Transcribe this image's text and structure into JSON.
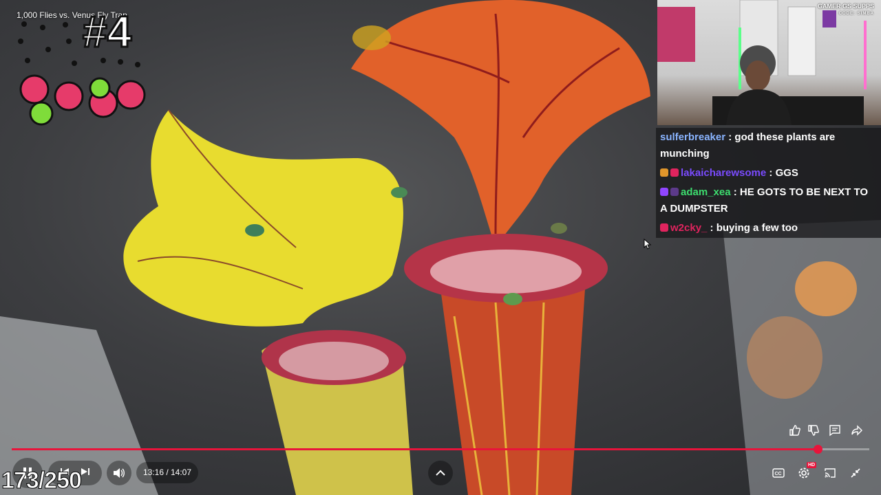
{
  "video": {
    "title": "1,000 Flies vs. Venus Fly Trap",
    "episode_label": "#4",
    "counter": "173/250",
    "time": "13:16 / 14:07",
    "progress": 0.94,
    "quality_badge": "HD"
  },
  "webcam": {
    "sponsor_brand": "GAMER GS SUPPS",
    "sponsor_code": "CODE: SIMBA"
  },
  "chat": {
    "messages": [
      {
        "user": "sulferbreaker",
        "sep": " : ",
        "text": "god these plants are munching",
        "color": "#8ab4ff"
      },
      {
        "user": "lakaicharewsome",
        "sep": " : ",
        "text": "GGS",
        "color": "#7a4bff"
      },
      {
        "user": "adam_xea",
        "sep": " : ",
        "text": "HE GOTS TO BE NEXT TO A DUMPSTER",
        "color": "#3ddc6e"
      },
      {
        "user": "w2cky_",
        "sep": " : ",
        "text": "buying a few too",
        "color": "#e0245e"
      }
    ]
  },
  "controls": {
    "play_pause": "play-pause-icon",
    "prev": "previous-icon",
    "next": "next-icon",
    "volume": "volume-icon",
    "expand": "chevron-up-icon",
    "like": "thumbs-up-icon",
    "dislike": "thumbs-down-icon",
    "comments": "comment-icon",
    "share": "share-icon",
    "captions": "cc-icon",
    "settings": "gear-icon",
    "cast": "cast-icon",
    "exit_fullscreen": "exit-fullscreen-icon"
  },
  "colors": {
    "accent": "#e8143b"
  }
}
